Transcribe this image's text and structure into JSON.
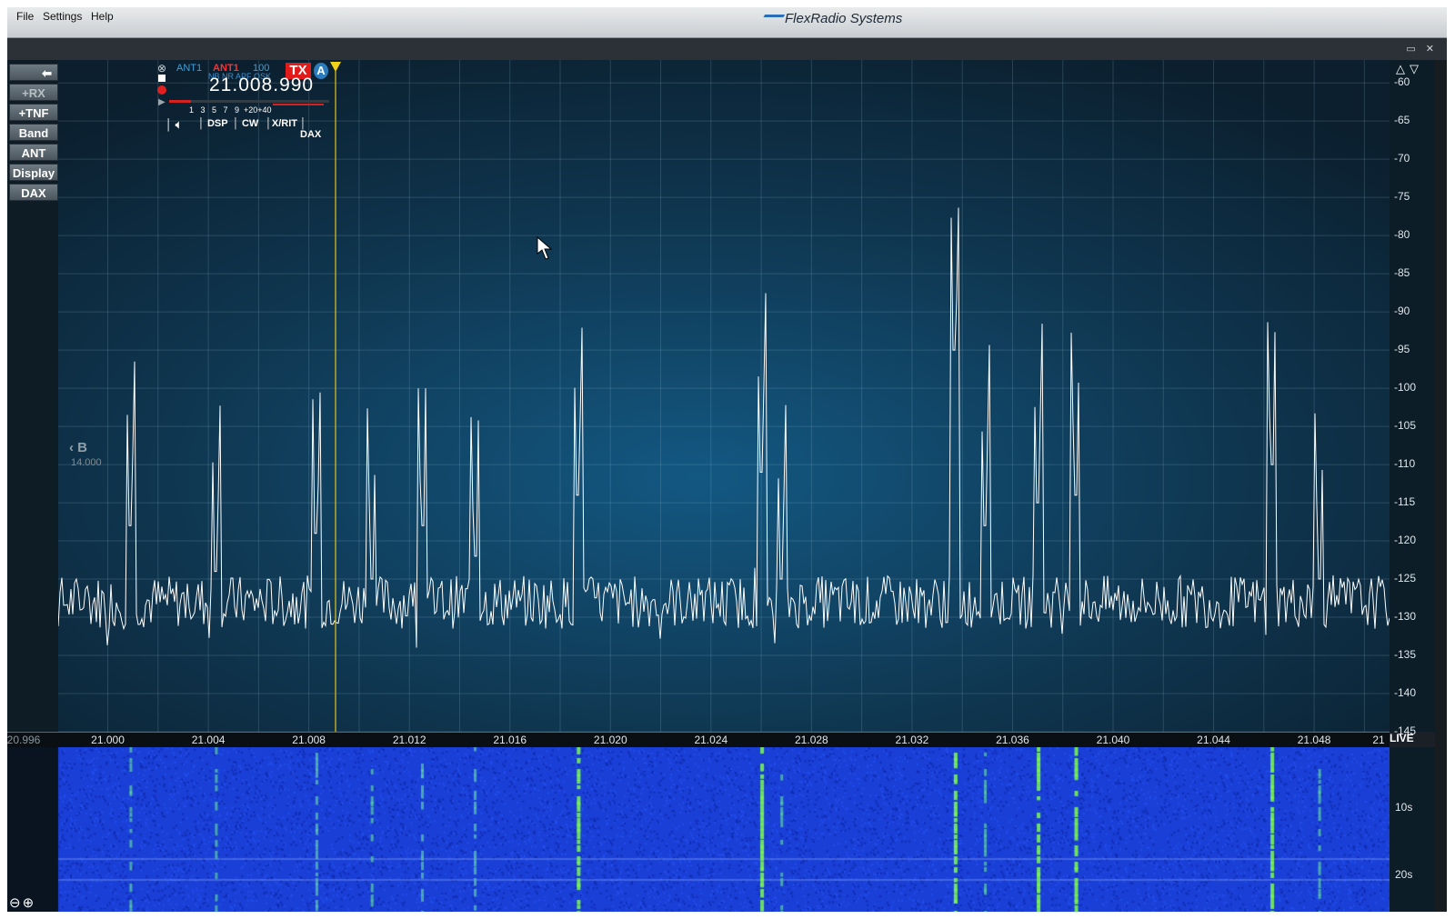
{
  "menu": {
    "file": "File",
    "settings": "Settings",
    "help": "Help"
  },
  "brand": "FlexRadio Systems",
  "window_controls": "▭ ✕",
  "sidebar": {
    "back": "⬅",
    "rx": "+RX",
    "tnf": "+TNF",
    "band": "Band",
    "ant": "ANT",
    "display": "Display",
    "dax": "DAX"
  },
  "slice_a": {
    "rx_ant": "ANT1",
    "tx_ant": "ANT1",
    "power": "100",
    "dsp_flags": "NB NR APF QSK",
    "tx_badge": "TX",
    "slice_letter": "A",
    "frequency": "21.008.990",
    "smeter_scale": "1   3   5   7   9  +20+40",
    "tabs": {
      "dsp": "DSP",
      "cw": "CW",
      "xrit": "X/RIT",
      "dax": "DAX"
    }
  },
  "slice_b": {
    "letter": "B",
    "frequency": "14.000"
  },
  "db_scale": [
    "-60",
    "-65",
    "-70",
    "-75",
    "-80",
    "-85",
    "-90",
    "-95",
    "-100",
    "-105",
    "-110",
    "-115",
    "-120",
    "-125",
    "-130",
    "-135",
    "-140",
    "-145"
  ],
  "freq_axis": [
    "20.996",
    "21.000",
    "21.004",
    "21.008",
    "21.012",
    "21.016",
    "21.020",
    "21.024",
    "21.028",
    "21.032",
    "21.036",
    "21.040",
    "21.044",
    "21.048",
    "21"
  ],
  "waterfall": {
    "live": "LIVE",
    "time_labels": [
      "10s",
      "20s"
    ]
  },
  "zoom": "⊖⊕",
  "colors": {
    "spectrum_bg": "#123a52",
    "trace": "#ffffff",
    "slice_marker": "#f2d11a",
    "waterfall": "#1a3fd6",
    "tx_badge": "#e11a1a"
  },
  "chart_data": {
    "type": "line",
    "xlabel": "",
    "ylabel": "",
    "xlim": [
      20.996,
      21.051
    ],
    "ylim": [
      -145,
      -57
    ],
    "noise_floor": -128,
    "signals": [
      {
        "freq": 21.0009,
        "level": -118
      },
      {
        "freq": 21.0043,
        "level": -124
      },
      {
        "freq": 21.0083,
        "level": -119
      },
      {
        "freq": 21.0105,
        "level": -125
      },
      {
        "freq": 21.0125,
        "level": -118
      },
      {
        "freq": 21.0146,
        "level": -122
      },
      {
        "freq": 21.0187,
        "level": -114
      },
      {
        "freq": 21.026,
        "level": -111
      },
      {
        "freq": 21.0268,
        "level": -125
      },
      {
        "freq": 21.0337,
        "level": -95
      },
      {
        "freq": 21.0349,
        "level": -118
      },
      {
        "freq": 21.037,
        "level": -115
      },
      {
        "freq": 21.0385,
        "level": -114
      },
      {
        "freq": 21.0463,
        "level": -110
      },
      {
        "freq": 21.0482,
        "level": -125
      }
    ]
  }
}
